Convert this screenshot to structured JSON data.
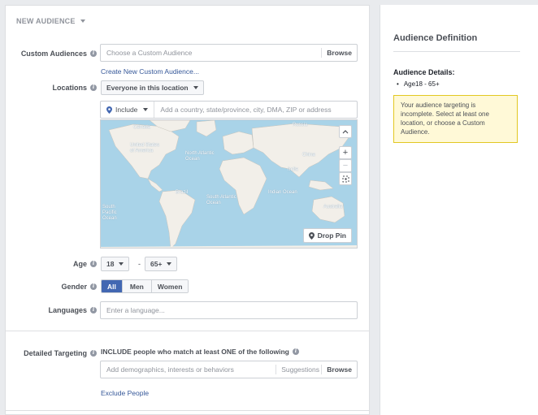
{
  "header": {
    "title": "NEW AUDIENCE"
  },
  "custom_audiences": {
    "label": "Custom Audiences",
    "placeholder": "Choose a Custom Audience",
    "browse_label": "Browse",
    "create_link": "Create New Custom Audience..."
  },
  "locations": {
    "label": "Locations",
    "dropdown_value": "Everyone in this location",
    "include_value": "Include",
    "search_placeholder": "Add a country, state/province, city, DMA, ZIP or address",
    "drop_pin_label": "Drop Pin",
    "map_labels": {
      "canada": "Canada",
      "usa": "United States of America",
      "russia": "Russia",
      "china": "China",
      "india": "India",
      "brazil": "Brazil",
      "australia": "Australia",
      "north_atlantic": "North Atlantic Ocean",
      "south_atlantic": "South Atlantic Ocean",
      "indian_ocean": "Indian Ocean",
      "south_pacific": "South Pacific Ocean"
    }
  },
  "age": {
    "label": "Age",
    "min": "18",
    "separator": "-",
    "max": "65+"
  },
  "gender": {
    "label": "Gender",
    "options": [
      "All",
      "Men",
      "Women"
    ],
    "selected": "All"
  },
  "languages": {
    "label": "Languages",
    "placeholder": "Enter a language..."
  },
  "detailed_targeting": {
    "label": "Detailed Targeting",
    "description": "INCLUDE people who match at least ONE of the following",
    "placeholder": "Add demographics, interests or behaviors",
    "suggestions_label": "Suggestions",
    "browse_label": "Browse",
    "exclude_link": "Exclude People"
  },
  "sidebar": {
    "title": "Audience Definition",
    "details_title": "Audience Details:",
    "details_item": "Age18 - 65+",
    "warning": "Your audience targeting is incomplete. Select at least one location, or choose a Custom Audience."
  },
  "colors": {
    "accent": "#4267b2",
    "link": "#365899",
    "warning_bg": "#fff9d7",
    "warning_border": "#e2c822"
  }
}
